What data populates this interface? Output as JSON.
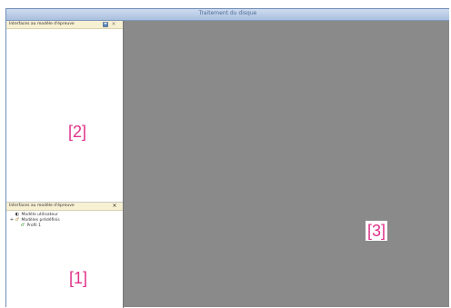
{
  "window": {
    "title": "Traitement du disque"
  },
  "sidebar": {
    "top_panel": {
      "title": "Interfaces au modèle d'épreuve",
      "icons": [
        "save-icon",
        "close-icon"
      ]
    },
    "bottom_panel": {
      "title": "Interfaces au modèle d'épreuve",
      "icons": [
        "close-icon"
      ],
      "tree": [
        {
          "label": "Modèle utilisateur",
          "icon": "model-icon",
          "expander": ""
        },
        {
          "label": "Modèles prédéfinis",
          "icon": "folder-link-icon",
          "expander": "+"
        },
        {
          "label": "Profil 1",
          "icon": "profile-icon",
          "expander": ""
        }
      ]
    }
  },
  "callouts": {
    "top_panel": "[2]",
    "bottom_panel": "[1]",
    "workspace": "[3]"
  },
  "colors": {
    "workspace": "#8a8a8a",
    "callout": "#e0328a",
    "panel_header": "#f7f0d2",
    "title_text": "#4f6e98"
  }
}
